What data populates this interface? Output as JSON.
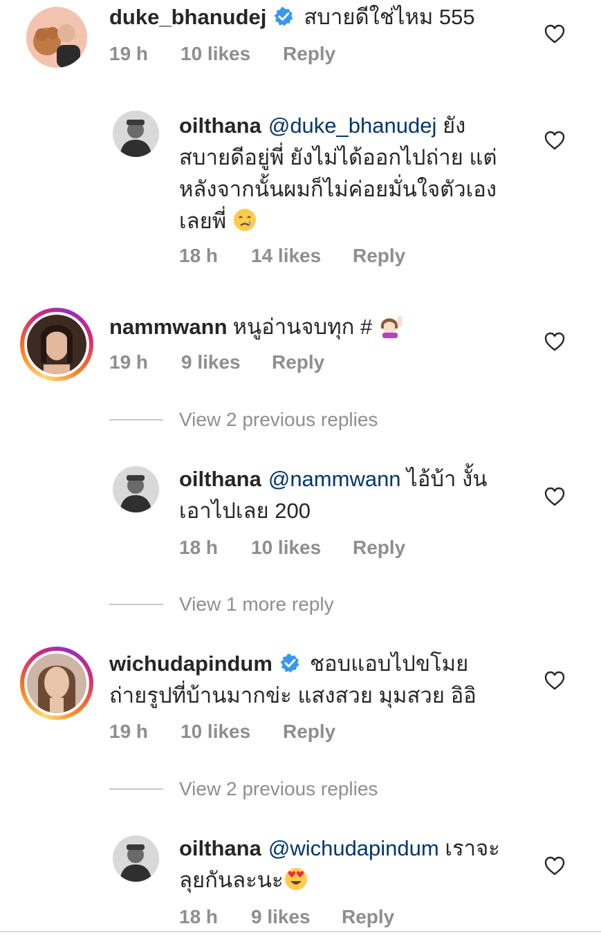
{
  "comments": {
    "c1": {
      "username": "duke_bhanudej",
      "text": "สบายดีใช่ไหม 555",
      "time": "19 h",
      "likes": "10 likes",
      "reply": "Reply"
    },
    "r1": {
      "username": "oilthana",
      "mention": "@duke_bhanudej",
      "text_line1": " ยัง",
      "text_line2": "สบายดีอยู่พี่ ยังไม่ได้ออกไปถ่าย แต่",
      "text_line3": "หลังจากนั้นผมก็ไม่ค่อยมั่นใจตัวเอง",
      "text_line4": "เลยพี่ ",
      "time": "18 h",
      "likes": "14 likes",
      "reply": "Reply"
    },
    "c2": {
      "username": "nammwann",
      "text": "หนูอ่านจบทุก # ",
      "time": "19 h",
      "likes": "9 likes",
      "reply": "Reply",
      "view_replies": "View 2 previous replies"
    },
    "r2": {
      "username": "oilthana",
      "mention": "@nammwann",
      "text_line1": " ไอ้บ้า งั้น",
      "text_line2": "เอาไปเลย 200",
      "time": "18 h",
      "likes": "10 likes",
      "reply": "Reply",
      "view_more": "View 1 more reply"
    },
    "c3": {
      "username": "wichudapindum",
      "text_line1": "ชอบแอบไปขโมย",
      "text_line2": "ถ่ายรูปที่บ้านมากข่ะ แสงสวย มุมสวย อิอิ",
      "time": "19 h",
      "likes": "10 likes",
      "reply": "Reply",
      "view_replies": "View 2 previous replies"
    },
    "r3": {
      "username": "oilthana",
      "mention": "@wichudapindum",
      "text_line1": " เราจะ",
      "text_line2": "ลุยกันละนะ",
      "time": "18 h",
      "likes": "9 likes",
      "reply": "Reply"
    }
  },
  "colors": {
    "text": "#262626",
    "secondary": "#8e8e8e",
    "mention": "#00376b",
    "verified": "#3897f0"
  },
  "icons": {
    "like": "heart-outline-icon",
    "verified": "verified-badge-icon"
  }
}
